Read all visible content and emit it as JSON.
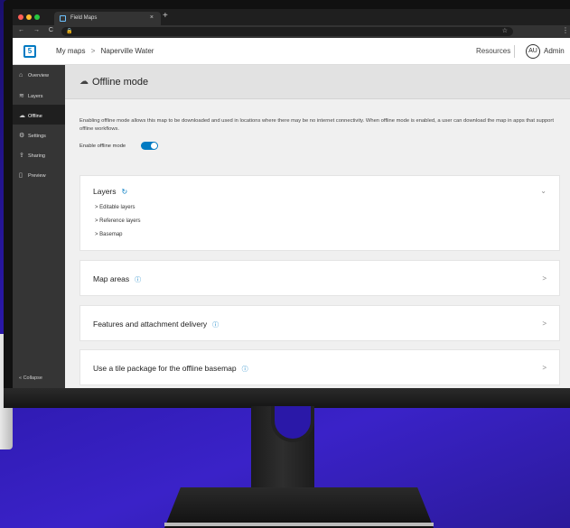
{
  "browser": {
    "tab_title": "Field Maps",
    "close": "×",
    "new_tab": "+",
    "nav": "← → C",
    "lock": "🔒",
    "star": "☆",
    "menu": "⋮"
  },
  "header": {
    "logo": "5",
    "breadcrumb_root": "My maps",
    "breadcrumb_sep": ">",
    "breadcrumb_current": "Naperville Water",
    "resources": "Resources",
    "avatar": "AU",
    "user": "Admin"
  },
  "sidebar": {
    "items": [
      {
        "label": "Overview",
        "icon": "⌂"
      },
      {
        "label": "Layers",
        "icon": "≋"
      },
      {
        "label": "Offline",
        "icon": "☁"
      },
      {
        "label": "Settings",
        "icon": "⚙"
      },
      {
        "label": "Sharing",
        "icon": "⇪"
      },
      {
        "label": "Preview",
        "icon": "▯"
      }
    ],
    "collapse": "«  Collapse"
  },
  "main": {
    "title": "Offline mode",
    "cloud_icon": "☁",
    "description": "Enabling offline mode allows this map to be downloaded and used in locations where there may be no internet connectivity. When offline mode is enabled, a user can download the map in apps that support offline workflows.",
    "toggle_label": "Enable offline mode",
    "toggle_on": true,
    "layers_card": {
      "title": "Layers",
      "refresh": "↻",
      "chevron": "⌄",
      "items": [
        ">  Editable layers",
        ">  Reference layers",
        ">  Basemap"
      ]
    },
    "cards": [
      {
        "title": "Map areas",
        "info": "ⓘ",
        "chevron": ">"
      },
      {
        "title": "Features and attachment delivery",
        "info": "ⓘ",
        "chevron": ">"
      },
      {
        "title": "Use a tile package for the offline basemap",
        "info": "ⓘ",
        "chevron": ">"
      }
    ]
  }
}
